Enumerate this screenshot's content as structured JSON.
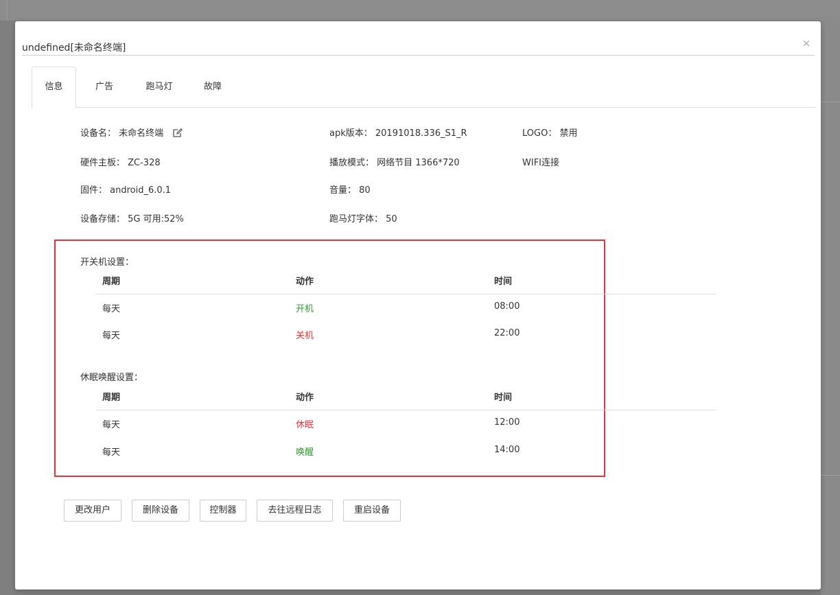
{
  "dialog": {
    "title": "undefined[未命名终端]",
    "close_symbol": "×"
  },
  "tabs": [
    {
      "label": "信息",
      "active": true
    },
    {
      "label": "广告",
      "active": false
    },
    {
      "label": "跑马灯",
      "active": false
    },
    {
      "label": "故障",
      "active": false
    }
  ],
  "info": {
    "device_name": "设备名： 未命名终端",
    "apk_version": "apk版本： 20191018.336_S1_R",
    "logo": "LOGO： 禁用",
    "hardware_board": "硬件主板： ZC-328",
    "play_mode": "播放模式： 网络节目 1366*720",
    "network": "WIFI连接",
    "firmware": "固件： android_6.0.1",
    "volume": "音量： 80",
    "storage": "设备存储： 5G 可用:52%",
    "marquee_font": "跑马灯字体： 50"
  },
  "power_schedule": {
    "title": "开关机设置：",
    "headers": [
      "周期",
      "动作",
      "时间"
    ],
    "rows": [
      {
        "period": "每天",
        "action": "开机",
        "time": "08:00",
        "action_color": "#2e9a2e"
      },
      {
        "period": "每天",
        "action": "关机",
        "time": "22:00",
        "action_color": "#e8323c"
      }
    ]
  },
  "sleep_schedule": {
    "title": "休眠唤醒设置：",
    "headers": [
      "周期",
      "动作",
      "时间"
    ],
    "rows": [
      {
        "period": "每天",
        "action": "休眠",
        "time": "12:00",
        "action_color": "#e8323c"
      },
      {
        "period": "每天",
        "action": "唤醒",
        "time": "14:00",
        "action_color": "#2e9a2e"
      }
    ]
  },
  "buttons": {
    "change_user": "更改用户",
    "delete_device": "删除设备",
    "controller": "控制器",
    "remote_log": "去往远程日志",
    "restart_device": "重启设备"
  },
  "icons": {
    "edit": "edit-icon",
    "close": "close-icon"
  },
  "colors": {
    "highlight_box": "#e8323c",
    "on_green": "#2e9a2e",
    "off_red": "#e8323c"
  }
}
